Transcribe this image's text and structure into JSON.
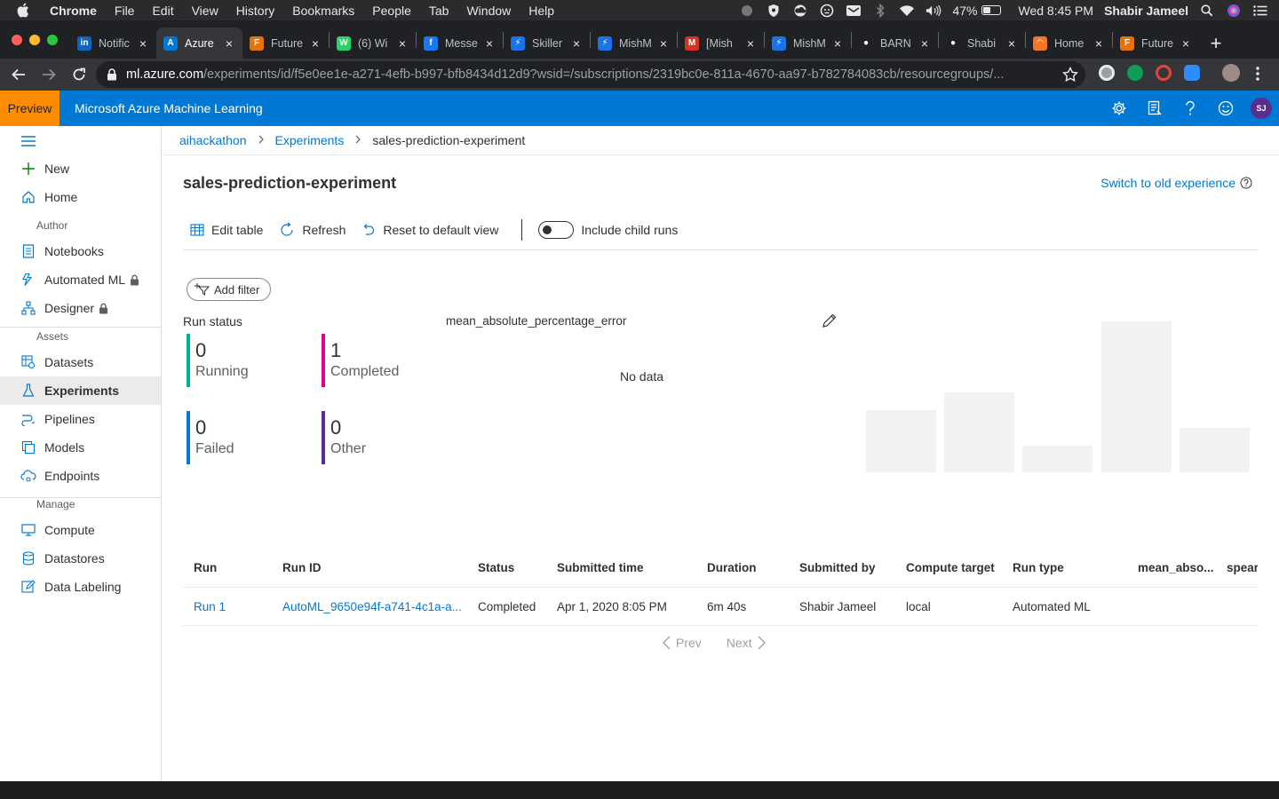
{
  "menubar": {
    "app": "Chrome",
    "items": [
      "File",
      "Edit",
      "View",
      "History",
      "Bookmarks",
      "People",
      "Tab",
      "Window",
      "Help"
    ],
    "battery": "47%",
    "battery_level": 0.47,
    "clock": "Wed 8:45 PM",
    "user": "Shabir Jameel"
  },
  "tabs": [
    {
      "title": "Notific",
      "favicon": "linkedin-icon",
      "color": "#0a66c2",
      "glyph": "in"
    },
    {
      "title": "Azure",
      "favicon": "azure-ml-icon",
      "color": "#0078d4",
      "glyph": "A",
      "active": true
    },
    {
      "title": "Future",
      "favicon": "book-icon",
      "color": "#e8710a",
      "glyph": "F"
    },
    {
      "title": "(6) Wi",
      "favicon": "whatsapp-icon",
      "color": "#25d366",
      "glyph": "W"
    },
    {
      "title": "Messe",
      "favicon": "facebook-icon",
      "color": "#1877f2",
      "glyph": "f"
    },
    {
      "title": "Skiller",
      "favicon": "bolt-icon",
      "color": "#1a73e8",
      "glyph": "⚡"
    },
    {
      "title": "MishM",
      "favicon": "bolt-icon",
      "color": "#1a73e8",
      "glyph": "⚡"
    },
    {
      "title": "[Mish",
      "favicon": "gmail-icon",
      "color": "#d93025",
      "glyph": "M"
    },
    {
      "title": "MishM",
      "favicon": "bolt-icon",
      "color": "#1a73e8",
      "glyph": "⚡"
    },
    {
      "title": "BARN",
      "favicon": "github-icon",
      "color": "#ffffff",
      "glyph": "●"
    },
    {
      "title": "Shabi",
      "favicon": "github-icon",
      "color": "#ffffff",
      "glyph": "●"
    },
    {
      "title": "Home",
      "favicon": "jupyter-icon",
      "color": "#f37626",
      "glyph": "◠"
    },
    {
      "title": "Future",
      "favicon": "book-icon",
      "color": "#e8710a",
      "glyph": "F"
    }
  ],
  "address": {
    "host": "ml.azure.com",
    "path": "/experiments/id/f5e0ee1e-a271-4efb-b997-bfb8434d12d9?wsid=/subscriptions/2319bc0e-811a-4670-aa97-b782784083cb/resourcegroups/..."
  },
  "azure_header": {
    "preview": "Preview",
    "title": "Microsoft Azure Machine Learning",
    "avatar_initials": "SJ"
  },
  "sidebar": {
    "new": "New",
    "home": "Home",
    "author_section": "Author",
    "notebooks": "Notebooks",
    "automated_ml": "Automated ML",
    "designer": "Designer",
    "assets_section": "Assets",
    "datasets": "Datasets",
    "experiments": "Experiments",
    "pipelines": "Pipelines",
    "models": "Models",
    "endpoints": "Endpoints",
    "manage_section": "Manage",
    "compute": "Compute",
    "datastores": "Datastores",
    "data_labeling": "Data Labeling"
  },
  "breadcrumb": {
    "workspace": "aihackathon",
    "experiments": "Experiments",
    "current": "sales-prediction-experiment"
  },
  "page": {
    "title": "sales-prediction-experiment",
    "switch_old": "Switch to old experience"
  },
  "commands": {
    "edit_table": "Edit table",
    "refresh": "Refresh",
    "reset_view": "Reset to default view",
    "include_child_runs": "Include child runs"
  },
  "filter": {
    "add_label": "Add filter"
  },
  "run_status": {
    "title": "Run status",
    "running": {
      "count": "0",
      "label": "Running",
      "color": "#00b294"
    },
    "completed": {
      "count": "1",
      "label": "Completed",
      "color": "#e3008c"
    },
    "failed": {
      "count": "0",
      "label": "Failed",
      "color": "#0078d4"
    },
    "other": {
      "count": "0",
      "label": "Other",
      "color": "#5c2d91"
    }
  },
  "metric": {
    "name": "mean_absolute_percentage_error",
    "no_data": "No data"
  },
  "table": {
    "columns": [
      "Run",
      "Run ID",
      "Status",
      "Submitted time",
      "Duration",
      "Submitted by",
      "Compute target",
      "Run type",
      "mean_abso...",
      "spear"
    ],
    "rows": [
      {
        "run": "Run 1",
        "run_id": "AutoML_9650e94f-a741-4c1a-a...",
        "status": "Completed",
        "submitted_time": "Apr 1, 2020 8:05 PM",
        "duration": "6m 40s",
        "submitted_by": "Shabir Jameel",
        "compute_target": "local",
        "run_type": "Automated ML"
      }
    ]
  },
  "pager": {
    "prev": "Prev",
    "next": "Next"
  }
}
